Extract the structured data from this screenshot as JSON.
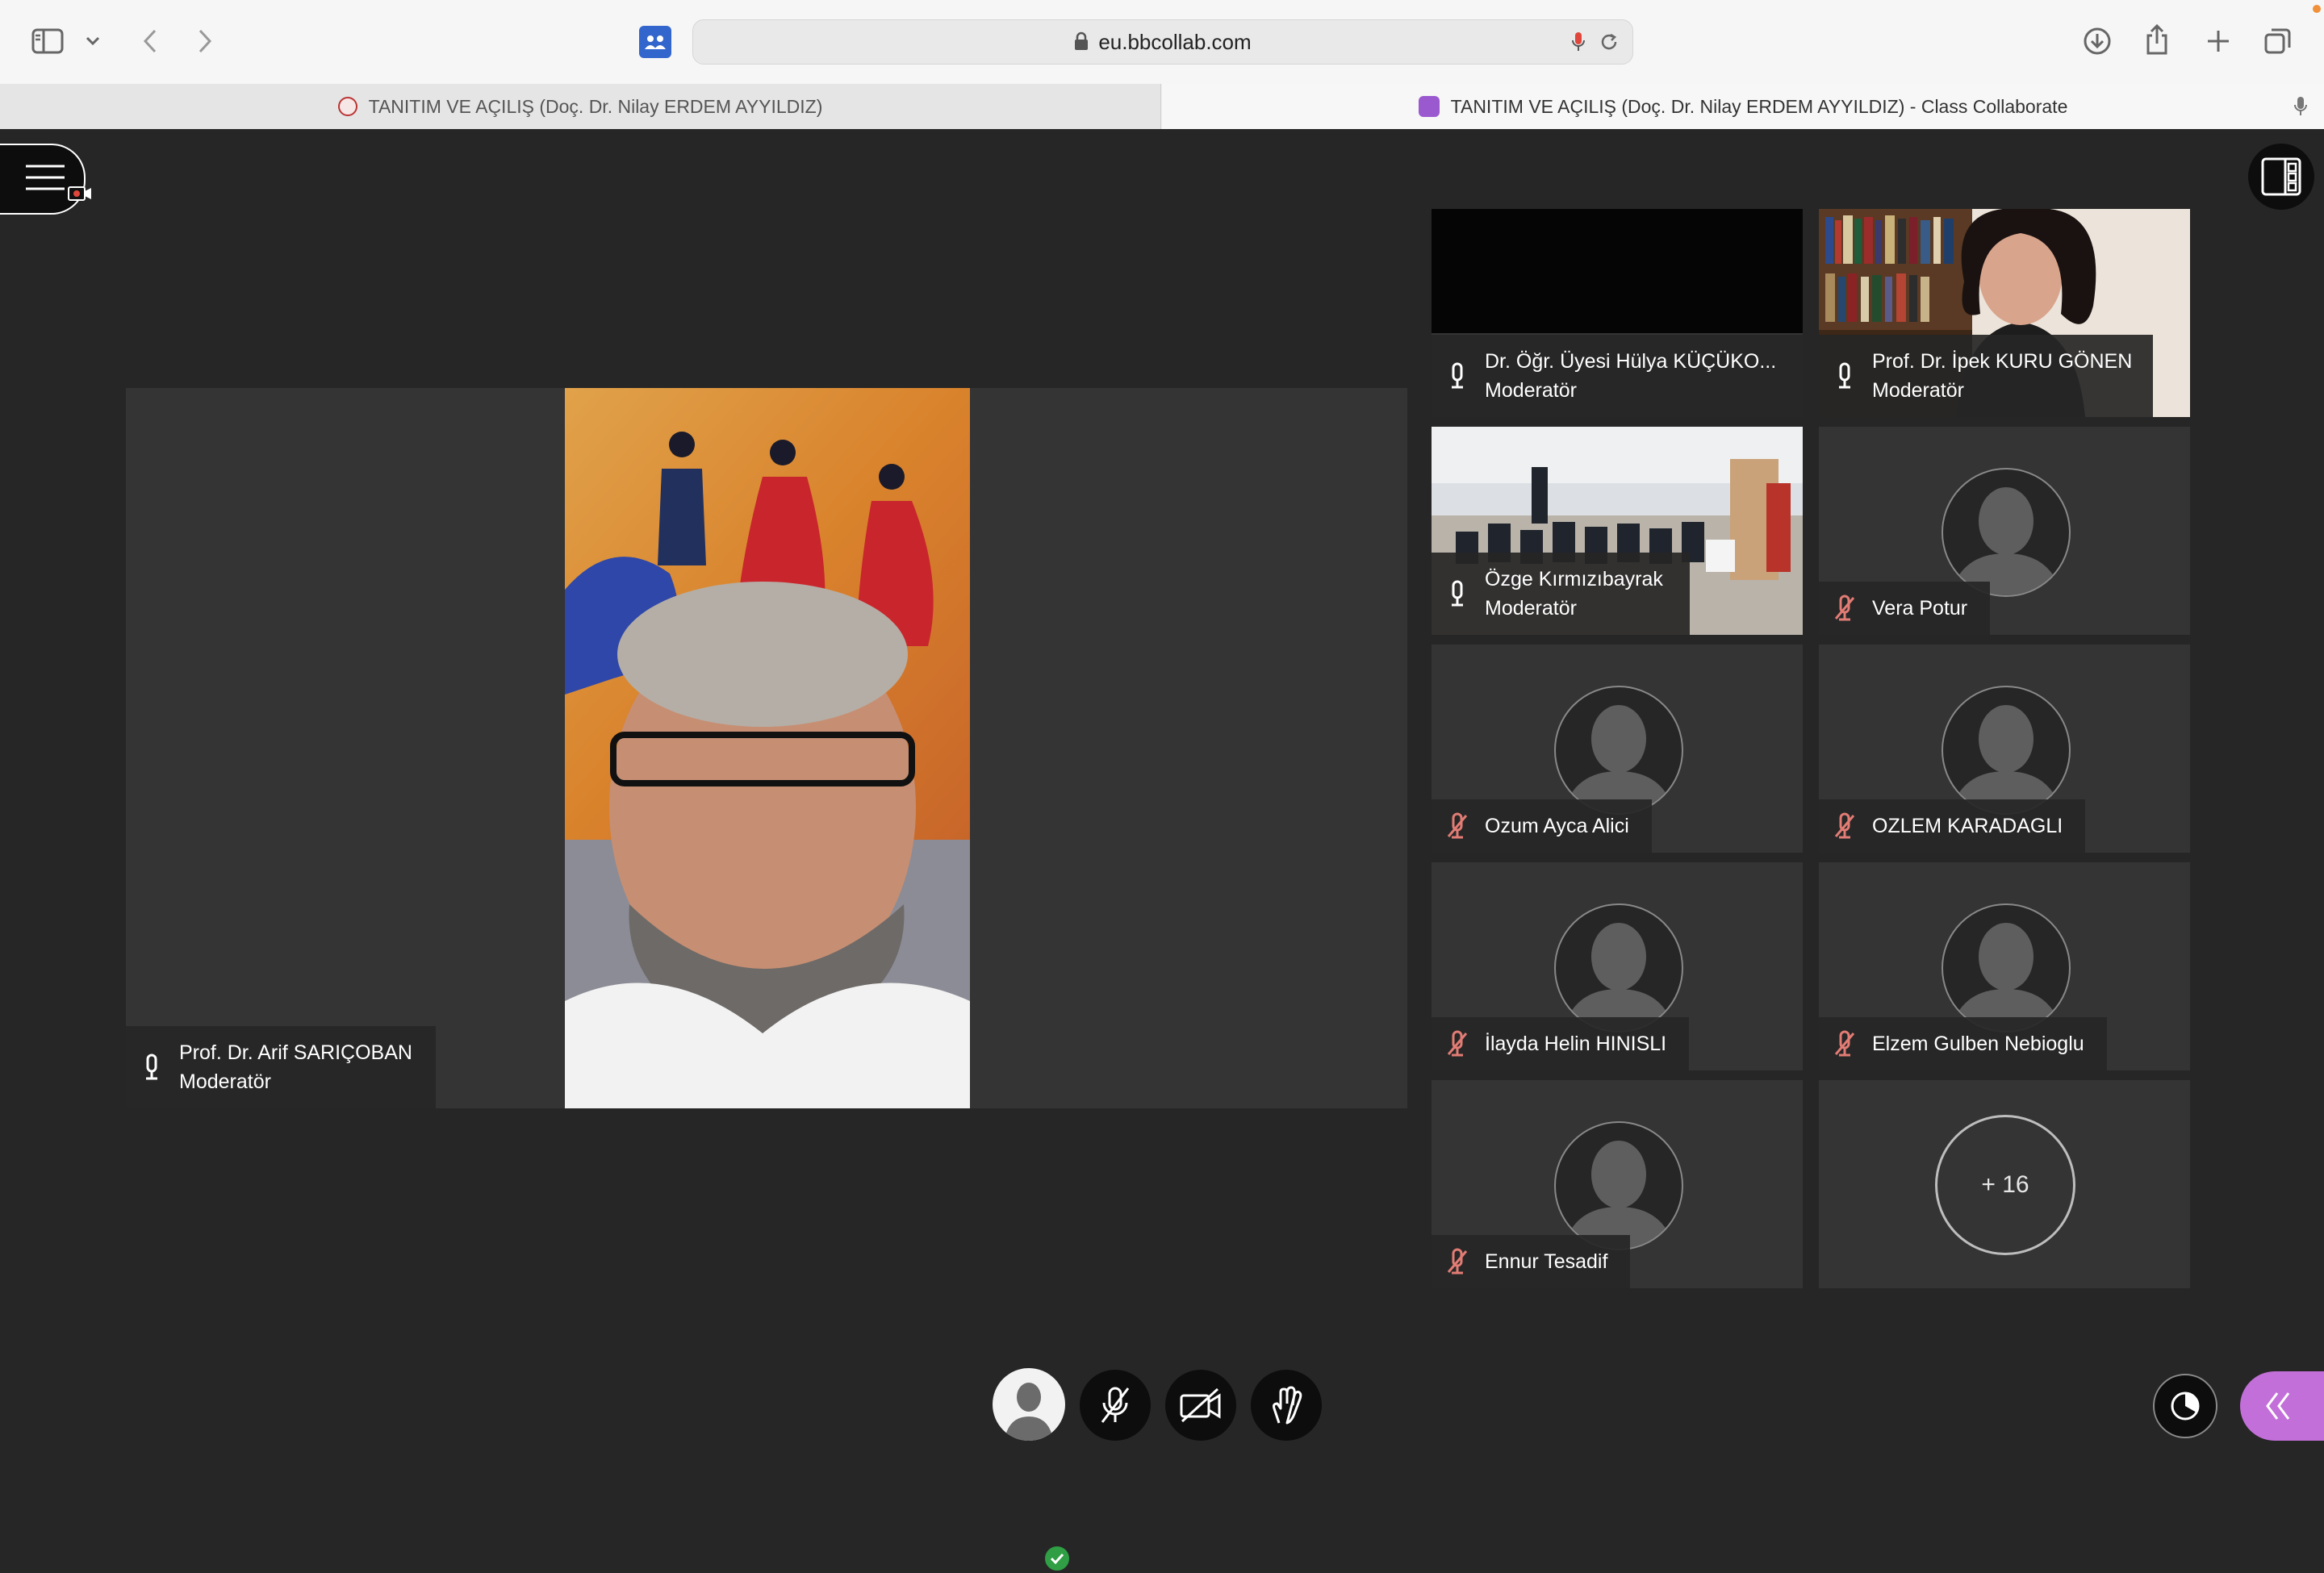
{
  "browser": {
    "url": "eu.bbcollab.com",
    "tabs": [
      {
        "label": "TANITIM VE AÇILIŞ (Doç. Dr. Nilay ERDEM AYYILDIZ)"
      },
      {
        "label": "TANITIM VE AÇILIŞ (Doç. Dr. Nilay ERDEM AYYILDIZ) - Class Collaborate"
      }
    ]
  },
  "main_speaker": {
    "name": "Prof. Dr. Arif SARIÇOBAN",
    "role": "Moderatör"
  },
  "participants": [
    {
      "name": "Dr. Öğr. Üyesi Hülya KÜÇÜKO...",
      "role": "Moderatör",
      "mic": "on"
    },
    {
      "name": "Prof. Dr. İpek KURU GÖNEN",
      "role": "Moderatör",
      "mic": "on"
    },
    {
      "name": "Özge Kırmızıbayrak",
      "role": "Moderatör",
      "mic": "on"
    },
    {
      "name": "Vera Potur",
      "role": "",
      "mic": "muted"
    },
    {
      "name": "Ozum Ayca Alici",
      "role": "",
      "mic": "muted"
    },
    {
      "name": "OZLEM KARADAGLI",
      "role": "",
      "mic": "muted"
    },
    {
      "name": "İlayda Helin HINISLI",
      "role": "",
      "mic": "muted"
    },
    {
      "name": "Elzem Gulben Nebioglu",
      "role": "",
      "mic": "muted"
    },
    {
      "name": "Ennur Tesadif",
      "role": "",
      "mic": "muted"
    }
  ],
  "overflow_count": "+ 16",
  "colors": {
    "muted_mic": "#e27c74",
    "panel_accent": "#c36fd9",
    "status_ok": "#2f9e44"
  },
  "icons": [
    "sidebar-icon",
    "chevron-down-icon",
    "back-icon",
    "forward-icon",
    "extension-icon",
    "lock-icon",
    "mic-icon",
    "reload-icon",
    "download-icon",
    "share-icon",
    "new-tab-icon",
    "tabs-overview-icon",
    "menu-icon",
    "layout-icon",
    "microphone-icon",
    "mic-muted-icon",
    "camera-off-icon",
    "raise-hand-icon",
    "profile-icon",
    "clock-icon",
    "collapse-icon"
  ]
}
